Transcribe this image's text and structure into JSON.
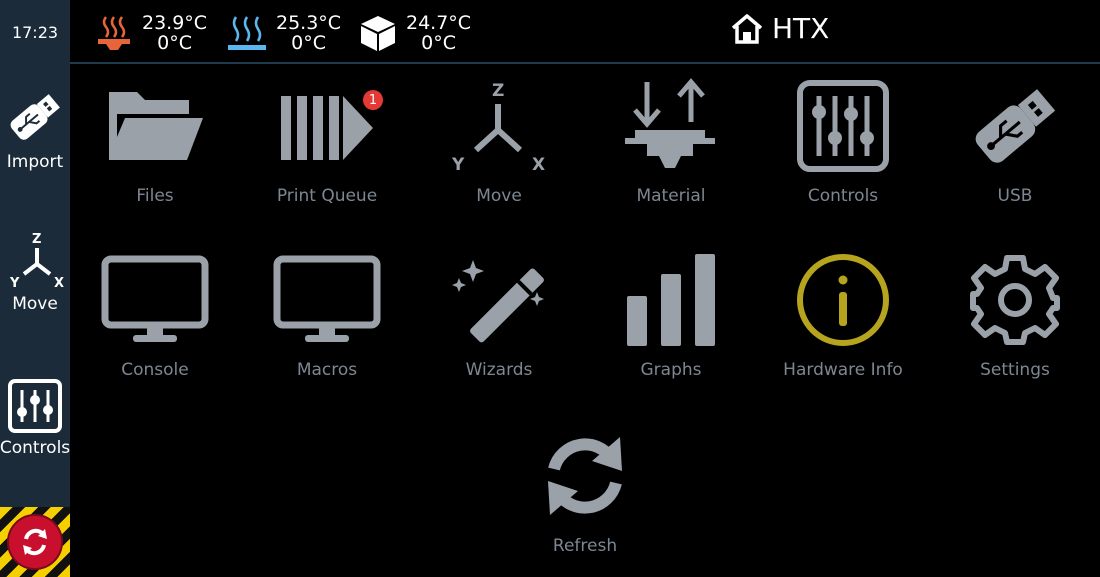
{
  "clock": "17:23",
  "sidebar": {
    "items": [
      {
        "label": "Import",
        "icon": "usb-drive-icon"
      },
      {
        "label": "Move",
        "icon": "xyz-axes-icon"
      },
      {
        "label": "Controls",
        "icon": "sliders-icon"
      }
    ],
    "estop_icon": "emergency-stop-icon"
  },
  "topbar": {
    "extruder": {
      "current": "23.9°C",
      "target": "0°C",
      "icon": "extruder-heater-icon",
      "color": "#e8653a"
    },
    "bed": {
      "current": "25.3°C",
      "target": "0°C",
      "icon": "heated-bed-icon",
      "color": "#5ab8ef"
    },
    "chamber": {
      "current": "24.7°C",
      "target": "0°C",
      "icon": "chamber-cube-icon",
      "color": "#ffffff"
    },
    "printer_name": "HTX"
  },
  "menu": {
    "files": "Files",
    "print_queue": "Print Queue",
    "print_queue_badge": "1",
    "move": "Move",
    "material": "Material",
    "controls": "Controls",
    "usb": "USB",
    "console": "Console",
    "macros": "Macros",
    "wizards": "Wizards",
    "graphs": "Graphs",
    "hardware_info": "Hardware Info",
    "settings": "Settings",
    "refresh": "Refresh"
  },
  "colors": {
    "icon_gray": "#9aa1a9",
    "label_gray": "#7d8792",
    "hardware_info_accent": "#b6a41f",
    "sidebar_bg": "#1b2b39",
    "badge_red": "#e53935"
  }
}
